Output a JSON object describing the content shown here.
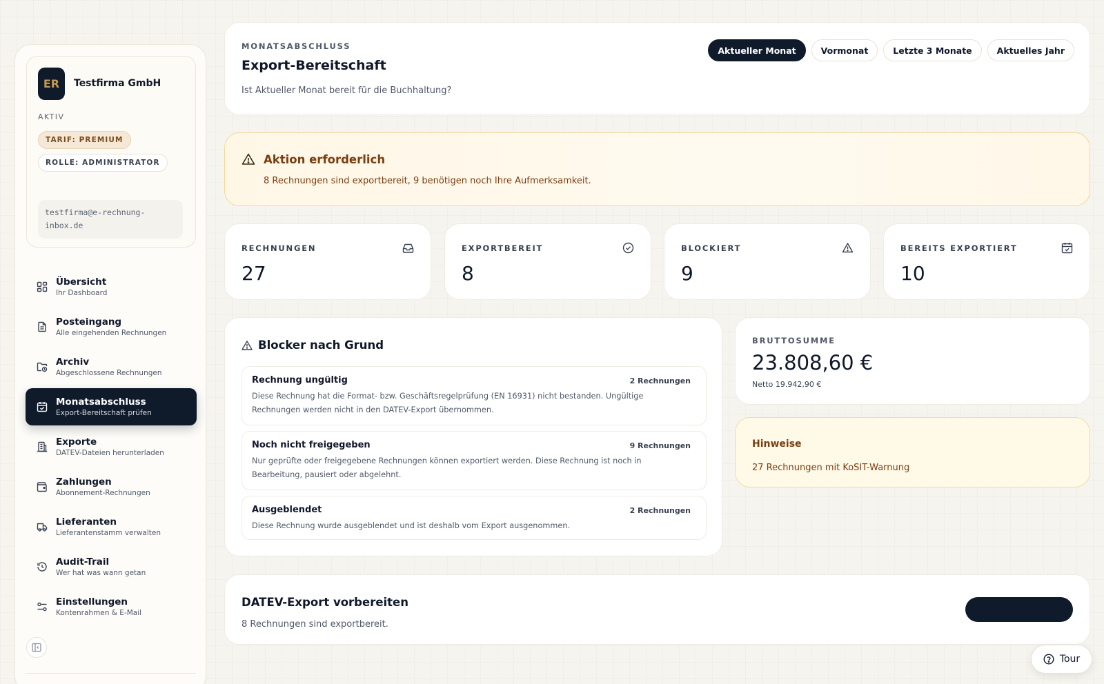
{
  "sidebar": {
    "avatar_initials": "ER",
    "company_name": "Testfirma GmbH",
    "status": "AKTIV",
    "tarif_badge": "TARIF: PREMIUM",
    "rolle_badge": "ROLLE: ADMINISTRATOR",
    "email": "testfirma@e-rechnung-inbox.de",
    "nav_items": [
      {
        "label": "Übersicht",
        "sub": "Ihr Dashboard",
        "icon": "dashboard-grid-icon",
        "active": false
      },
      {
        "label": "Posteingang",
        "sub": "Alle eingehenden Rechnungen",
        "icon": "document-icon",
        "active": false
      },
      {
        "label": "Archiv",
        "sub": "Abgeschlossene Rechnungen",
        "icon": "folder-clock-icon",
        "active": false
      },
      {
        "label": "Monatsabschluss",
        "sub": "Export-Bereitschaft prüfen",
        "icon": "calendar-check-icon",
        "active": true
      },
      {
        "label": "Exporte",
        "sub": "DATEV-Dateien herunterladen",
        "icon": "building-icon",
        "active": false
      },
      {
        "label": "Zahlungen",
        "sub": "Abonnement-Rechnungen",
        "icon": "wallet-icon",
        "active": false
      },
      {
        "label": "Lieferanten",
        "sub": "Lieferantenstamm verwalten",
        "icon": "truck-icon",
        "active": false
      },
      {
        "label": "Audit-Trail",
        "sub": "Wer hat was wann getan",
        "icon": "history-icon",
        "active": false
      },
      {
        "label": "Einstellungen",
        "sub": "Kontenrahmen & E-Mail",
        "icon": "sliders-icon",
        "active": false
      }
    ],
    "collapse_icon": "sidebar-collapse-icon"
  },
  "header": {
    "eyebrow": "MONATSABSCHLUSS",
    "title": "Export-Bereitschaft",
    "subtitle": "Ist Aktueller Monat bereit für die Buchhaltung?",
    "period_tabs": [
      {
        "label": "Aktueller Monat",
        "active": true
      },
      {
        "label": "Vormonat",
        "active": false
      },
      {
        "label": "Letzte 3 Monate",
        "active": false
      },
      {
        "label": "Aktuelles Jahr",
        "active": false
      }
    ]
  },
  "alert": {
    "icon": "warning-triangle-icon",
    "title": "Aktion erforderlich",
    "text": "8 Rechnungen sind exportbereit, 9 benötigen noch Ihre Aufmerksamkeit."
  },
  "stats": [
    {
      "label": "RECHNUNGEN",
      "value": "27",
      "icon": "inbox-icon"
    },
    {
      "label": "EXPORTBEREIT",
      "value": "8",
      "icon": "check-circle-icon"
    },
    {
      "label": "BLOCKIERT",
      "value": "9",
      "icon": "warning-triangle-icon"
    },
    {
      "label": "BEREITS EXPORTIERT",
      "value": "10",
      "icon": "calendar-check-icon"
    }
  ],
  "blockers": {
    "title": "Blocker nach Grund",
    "reasons": [
      {
        "title": "Rechnung ungültig",
        "count": "2 Rechnungen",
        "text": "Diese Rechnung hat die Format- bzw. Geschäftsregelprüfung (EN 16931) nicht bestanden. Ungültige Rechnungen werden nicht in den DATEV-Export übernommen."
      },
      {
        "title": "Noch nicht freigegeben",
        "count": "9 Rechnungen",
        "text": "Nur geprüfte oder freigegebene Rechnungen können exportiert werden. Diese Rechnung ist noch in Bearbeitung, pausiert oder abgelehnt."
      },
      {
        "title": "Ausgeblendet",
        "count": "2 Rechnungen",
        "text": "Diese Rechnung wurde ausgeblendet und ist deshalb vom Export ausgenommen."
      }
    ]
  },
  "brutto": {
    "label": "BRUTTOSUMME",
    "value": "23.808,60 €",
    "netto": "Netto 19.942,90 €"
  },
  "hinweise": {
    "title": "Hinweise",
    "text": "27 Rechnungen mit KoSIT-Warnung"
  },
  "datev": {
    "title": "DATEV-Export vorbereiten",
    "text": "8 Rechnungen sind exportbereit.",
    "button_label": ""
  },
  "tour": {
    "label": "Tour",
    "icon": "help-circle-icon"
  }
}
